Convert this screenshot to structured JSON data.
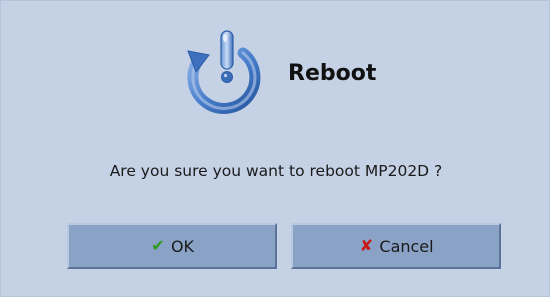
{
  "dialog": {
    "title": "Reboot",
    "icon": "power-icon",
    "message": "Are you sure you want to reboot MP202D ?"
  },
  "buttons": {
    "ok": {
      "label": "OK",
      "icon": "check-icon",
      "icon_glyph": "✔",
      "icon_color": "#2f9a1d"
    },
    "cancel": {
      "label": "Cancel",
      "icon": "cross-icon",
      "icon_glyph": "✘",
      "icon_color": "#c81818"
    }
  },
  "colors": {
    "background": "#c5d2e6",
    "button_fill": "#8aa2c6",
    "icon_blue": "#3d6fc0"
  }
}
